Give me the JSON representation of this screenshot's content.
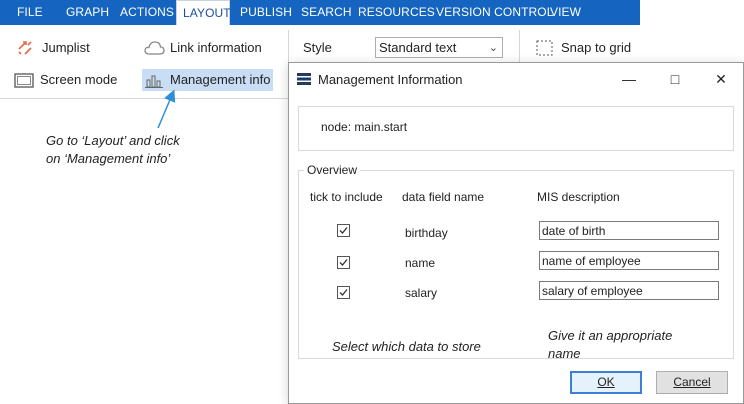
{
  "menubar": {
    "items": [
      "FILE",
      "GRAPH",
      "ACTIONS",
      "LAYOUT",
      "PUBLISH",
      "SEARCH",
      "RESOURCES",
      "VERSION CONTROL",
      "VIEW"
    ],
    "active": "LAYOUT"
  },
  "ribbon": {
    "jumplist": "Jumplist",
    "link_information": "Link information",
    "style_label": "Style",
    "style_value": "Standard text",
    "snap_to_grid": "Snap to grid",
    "screen_mode": "Screen mode",
    "management_info": "Management info"
  },
  "annotations": {
    "layout_hint_line1": "Go to ‘Layout’ and click",
    "layout_hint_line2": "on ‘Management info’",
    "select_hint": "Select which data to store",
    "name_hint_line1": "Give it an appropriate",
    "name_hint_line2": "name"
  },
  "dialog": {
    "title": "Management Information",
    "node_text": "node: main.start",
    "overview_title": "Overview",
    "columns": [
      "tick to include",
      "data field name",
      "MIS description"
    ],
    "rows": [
      {
        "checked": true,
        "field": "birthday",
        "description": "date of birth"
      },
      {
        "checked": true,
        "field": "name",
        "description": "name of employee"
      },
      {
        "checked": true,
        "field": "salary",
        "description": "salary of employee"
      }
    ],
    "ok_label": "OK",
    "cancel_label": "Cancel"
  },
  "colors": {
    "ribbon_blue": "#1565c0",
    "highlight": "#c9ddf4",
    "arrow": "#2e8fd8",
    "jumplist_icon": "#e8664a"
  }
}
